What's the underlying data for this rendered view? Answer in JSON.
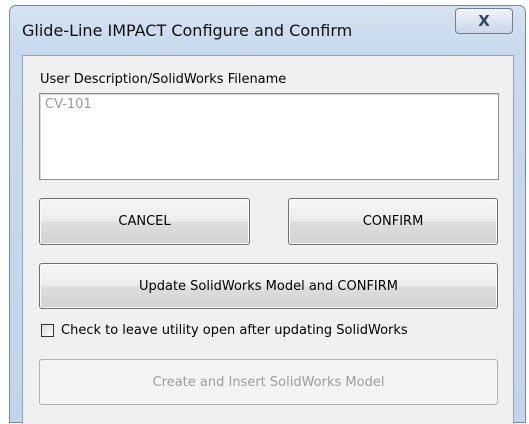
{
  "window": {
    "title": "Glide-Line IMPACT Configure and Confirm",
    "close_glyph": "X"
  },
  "form": {
    "description_label": "User Description/SolidWorks Filename",
    "description_value": "CV-101",
    "cancel_label": "CANCEL",
    "confirm_label": "CONFIRM",
    "update_label": "Update SolidWorks Model and CONFIRM",
    "leave_open_label": "Check to leave utility open after updating SolidWorks",
    "leave_open_checked": false,
    "create_label": "Create and Insert SolidWorks Model",
    "create_enabled": false
  }
}
